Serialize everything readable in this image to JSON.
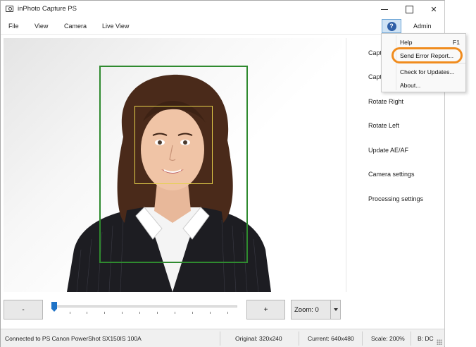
{
  "window": {
    "title": "inPhoto Capture PS",
    "icon": "app-camera-icon"
  },
  "menu": {
    "file": "File",
    "view": "View",
    "camera": "Camera",
    "live_view": "Live View",
    "help_icon": "?",
    "admin": "Admin"
  },
  "side_panel": {
    "items": [
      "Capt",
      "Capt",
      "Rotate Right",
      "Rotate Left",
      "Update AE/AF",
      "Camera settings",
      "Processing settings"
    ]
  },
  "controls": {
    "zoom_out": "-",
    "zoom_in": "+",
    "zoom_label": "Zoom: 0",
    "slider_level": 0
  },
  "status": {
    "connection": "Connected to PS Canon PowerShot SX150IS 100A",
    "original": "Original: 320x240",
    "current": "Current: 640x480",
    "scale": "Scale: 200%",
    "b": "B: DC"
  },
  "help_menu": {
    "help": "Help",
    "help_shortcut": "F1",
    "send_error": "Send Error Report...",
    "check_updates": "Check for Updates...",
    "about": "About..."
  },
  "colors": {
    "face_frame": "#2f8a2f",
    "eye_frame": "#e6d14a",
    "highlight": "#f08c1e",
    "slider": "#1f73c7"
  }
}
